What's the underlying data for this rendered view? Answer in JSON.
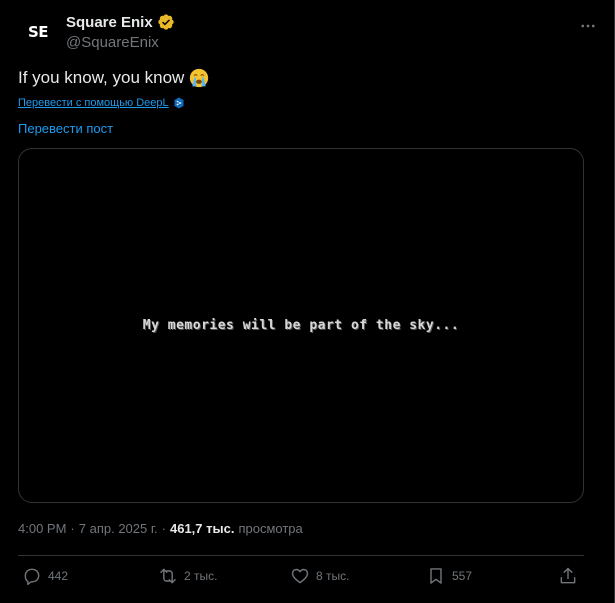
{
  "author": {
    "avatar_text": "SE",
    "name": "Square Enix",
    "handle": "@SquareEnix"
  },
  "tweet": {
    "text": "If you know, you know",
    "deepl_link": "Перевести с помощью DeepL",
    "translate_link": "Перевести пост",
    "media_caption": "My memories will be part of the sky..."
  },
  "meta": {
    "time": "4:00 PM",
    "sep1": "·",
    "date": "7 апр. 2025 г.",
    "sep2": "·",
    "views_count": "461,7 тыс.",
    "views_label": "просмотра"
  },
  "actions": {
    "replies": "442",
    "reposts": "2 тыс.",
    "likes": "8 тыс.",
    "bookmarks": "557"
  },
  "icons": [
    "verified-badge-icon",
    "more-icon",
    "crying-emoji-icon",
    "deepl-icon",
    "reply-icon",
    "repost-icon",
    "like-icon",
    "bookmark-icon",
    "share-icon"
  ],
  "colors": {
    "accent": "#1d9bf0",
    "verified": "#e8b829",
    "muted": "#71767b"
  }
}
